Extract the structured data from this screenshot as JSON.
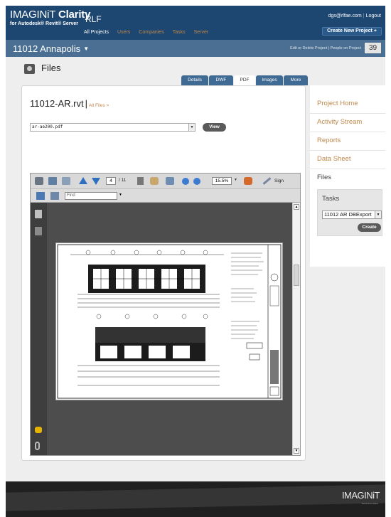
{
  "header": {
    "logo_main": "IMAGINiT",
    "logo_bold": "Clarity",
    "logo_sub": "for Autodesk® Revit® Server",
    "tenant": "RLF",
    "nav": [
      "All Projects",
      "Users",
      "Companies",
      "Tasks",
      "Server"
    ],
    "nav_active_index": 0,
    "user_email": "dgs@rlfae.com",
    "logout": "Logout",
    "create_new_project": "Create New Project +"
  },
  "project_bar": {
    "name": "11012 Annapolis",
    "links": "Edit or Delete Project | People on Project",
    "count": "39"
  },
  "files": {
    "title": "Files",
    "tabs": [
      "Details",
      "DWF",
      "PDF",
      "Images",
      "More"
    ],
    "active_tab_index": 2,
    "file_name": "11012-AR.rvt",
    "all_files": "All Files >",
    "selected_pdf": "ar-ae200.pdf",
    "view_button": "View"
  },
  "pdf_viewer": {
    "page_current": "4",
    "page_total": "/ 11",
    "zoom": "15.5%",
    "sign_label": "Sign",
    "find_placeholder": "Find"
  },
  "sidebar": {
    "links": [
      "Project Home",
      "Activity Stream",
      "Reports",
      "Data Sheet"
    ],
    "current": "Files",
    "tasks_title": "Tasks",
    "task_selected": "11012 AR DBExport",
    "create_button": "Create"
  },
  "footer": {
    "logo": "IMAGINiT",
    "sub": "TECHNOLOGIES"
  },
  "colors": {
    "header_bg": "#1d4670",
    "project_bar_bg": "#4a6f92",
    "link_accent": "#c0884a",
    "tab_bg": "#3f6a94",
    "button_bg": "#5a5a5a"
  },
  "icons": [
    "printer-icon",
    "save-icon",
    "email-icon",
    "previous-page-icon",
    "next-page-icon",
    "select-tool-icon",
    "hand-tool-icon",
    "marquee-zoom-icon",
    "zoom-out-icon",
    "zoom-in-icon",
    "tools-icon",
    "sign-pen-icon",
    "pages-panel-icon",
    "fit-page-icon",
    "layers-icon",
    "comments-icon",
    "attachments-icon"
  ]
}
